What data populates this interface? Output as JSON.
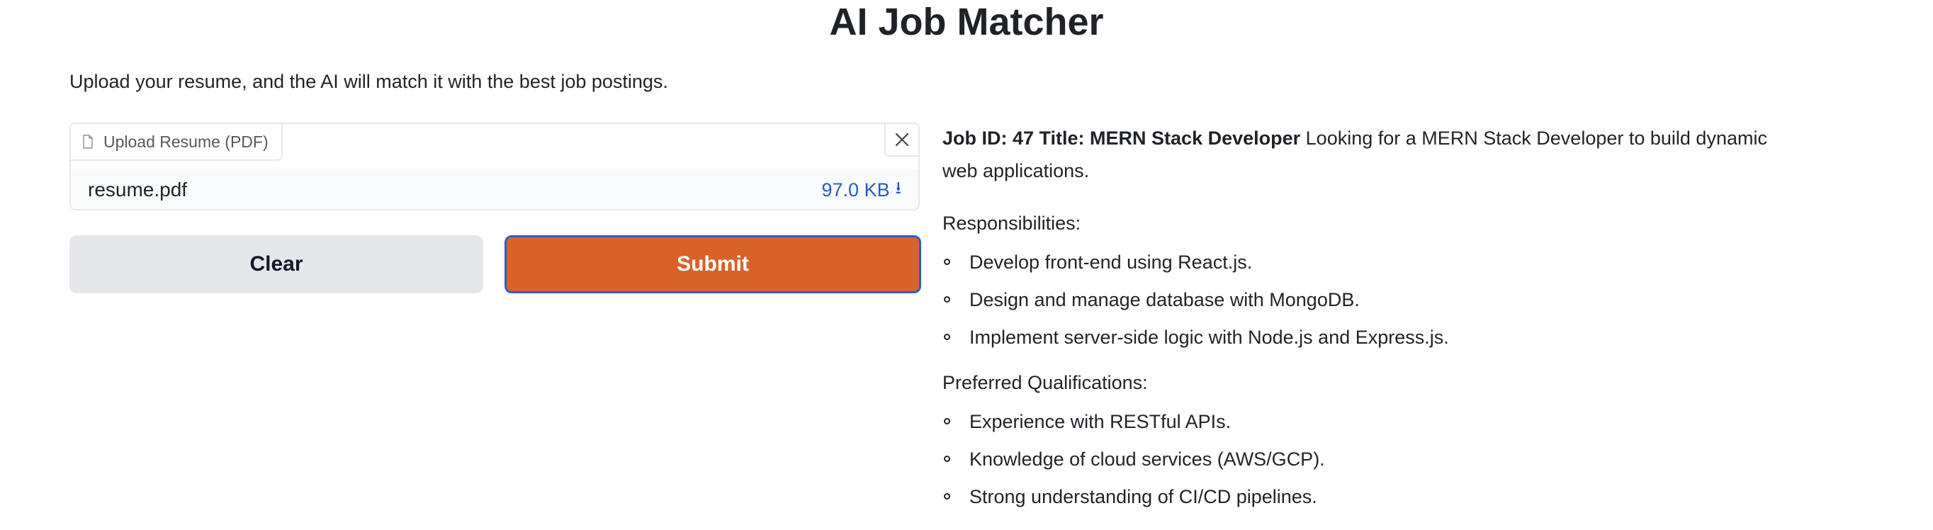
{
  "page": {
    "title": "AI Job Matcher",
    "description": "Upload your resume, and the AI will match it with the best job postings."
  },
  "upload": {
    "label": "Upload Resume (PDF)",
    "file_name": "resume.pdf",
    "file_size": "97.0 KB",
    "download_glyph": "⭳"
  },
  "buttons": {
    "clear": "Clear",
    "submit": "Submit"
  },
  "job": {
    "id_label": "Job ID: 47 Title: MERN Stack Developer",
    "summary": " Looking for a MERN Stack Developer to build dynamic web applications.",
    "responsibilities_title": "Responsibilities:",
    "responsibilities": [
      "Develop front-end using React.js.",
      "Design and manage database with MongoDB.",
      "Implement server-side logic with Node.js and Express.js."
    ],
    "qualifications_title": "Preferred Qualifications:",
    "qualifications": [
      "Experience with RESTful APIs.",
      "Knowledge of cloud services (AWS/GCP).",
      "Strong understanding of CI/CD pipelines."
    ]
  },
  "colors": {
    "submit": "#d9622b",
    "submit_border": "#2f5ec4",
    "clear": "#e5e7eb",
    "link": "#2b59c3"
  },
  "icons": {
    "upload_label_icon": "file-icon",
    "close": "close-icon",
    "download": "download-icon",
    "bullet": "hollow-circle-bullet"
  }
}
